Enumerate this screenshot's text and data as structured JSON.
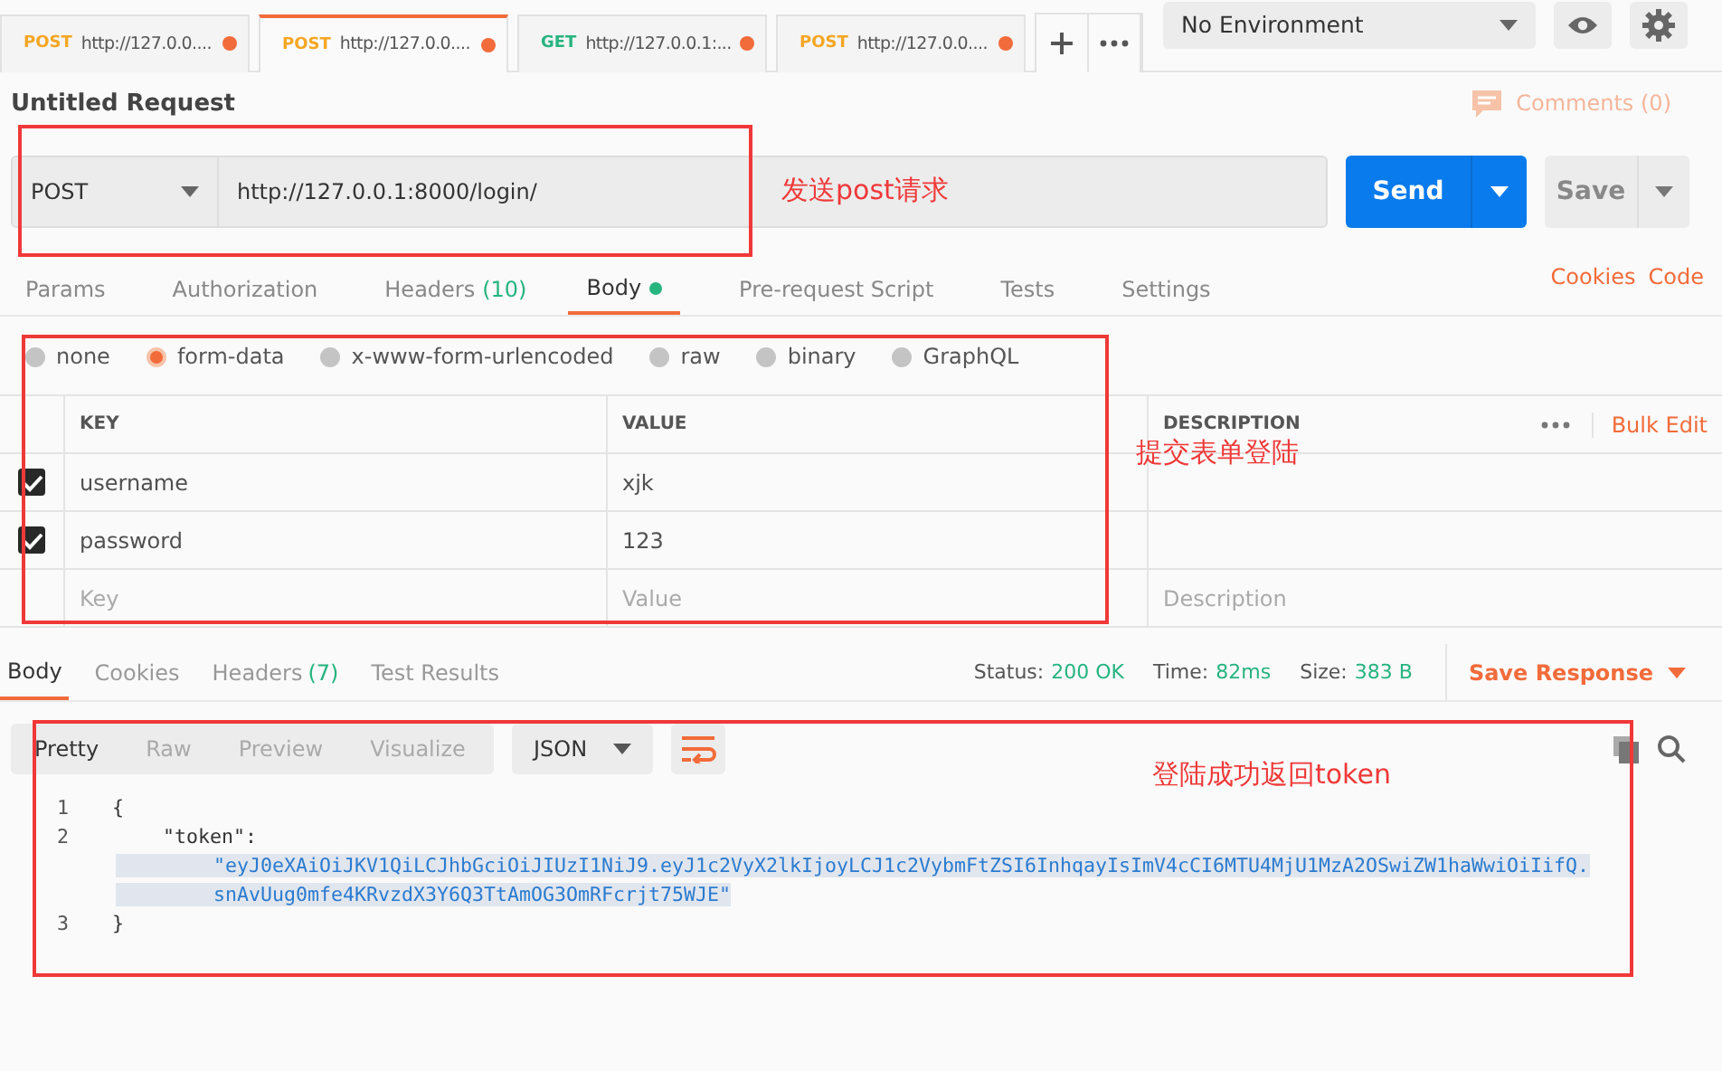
{
  "request_tabs": [
    {
      "method": "POST",
      "url": "http://127.0.0....",
      "selected": false,
      "unsaved": true
    },
    {
      "method": "POST",
      "url": "http://127.0.0....",
      "selected": true,
      "unsaved": true
    },
    {
      "method": "GET",
      "url": "http://127.0.0.1:...",
      "selected": false,
      "unsaved": true
    },
    {
      "method": "POST",
      "url": "http://127.0.0....",
      "selected": false,
      "unsaved": true
    }
  ],
  "environment": {
    "value": "No Environment"
  },
  "request": {
    "title": "Untitled Request",
    "comments": "Comments (0)",
    "method": "POST",
    "url": "http://127.0.0.1:8000/login/",
    "send": "Send",
    "save": "Save"
  },
  "request_sections": [
    {
      "label": "Params",
      "selected": false
    },
    {
      "label": "Authorization",
      "selected": false
    },
    {
      "label": "Headers",
      "count": "(10)",
      "selected": false
    },
    {
      "label": "Body",
      "selected": true,
      "dot": true
    },
    {
      "label": "Pre-request Script",
      "selected": false
    },
    {
      "label": "Tests",
      "selected": false
    },
    {
      "label": "Settings",
      "selected": false
    }
  ],
  "request_links": [
    "Cookies",
    "Code"
  ],
  "body_types": [
    {
      "label": "none",
      "selected": false
    },
    {
      "label": "form-data",
      "selected": true
    },
    {
      "label": "x-www-form-urlencoded",
      "selected": false
    },
    {
      "label": "raw",
      "selected": false
    },
    {
      "label": "binary",
      "selected": false
    },
    {
      "label": "GraphQL",
      "selected": false
    }
  ],
  "params_table": {
    "columns": [
      "KEY",
      "VALUE",
      "DESCRIPTION"
    ],
    "bulk_edit": "Bulk Edit",
    "rows": [
      {
        "key": "username",
        "value": "xjk",
        "checked": true
      },
      {
        "key": "password",
        "value": "123",
        "checked": true
      }
    ],
    "placeholder": {
      "key": "Key",
      "value": "Value",
      "description": "Description"
    }
  },
  "response_tabs": [
    {
      "label": "Body",
      "selected": true
    },
    {
      "label": "Cookies",
      "selected": false
    },
    {
      "label": "Headers",
      "count": "(7)",
      "selected": false
    },
    {
      "label": "Test Results",
      "selected": false
    }
  ],
  "response_meta": [
    {
      "label": "Status:",
      "value": "200 OK"
    },
    {
      "label": "Time:",
      "value": "82ms"
    },
    {
      "label": "Size:",
      "value": "383 B"
    }
  ],
  "save_response": "Save Response",
  "view_modes": [
    {
      "label": "Pretty",
      "selected": true
    },
    {
      "label": "Raw",
      "selected": false
    },
    {
      "label": "Preview",
      "selected": false
    },
    {
      "label": "Visualize",
      "selected": false
    }
  ],
  "format": "JSON",
  "code_lines": [
    {
      "number": "1",
      "text": "{"
    },
    {
      "number": "2",
      "text": "\"token\":",
      "continuation": [
        "\"eyJ0eXAiOiJKV1QiLCJhbGciOiJIUzI1NiJ9.eyJ1c2VyX2lkIjoyLCJ1c2VybmFtZSI6InhqayIsImV4cCI6MTU4MjU1MzA2OSwiZW1haWwiOiIifQ.",
        "snAvUug0mfe4KRvzdX3Y6Q3TtAmOG3OmRFcrjt75WJE\""
      ],
      "selected": true
    },
    {
      "number": "3",
      "text": "}"
    }
  ],
  "annotations": [
    "发送post请求",
    "提交表单登陆",
    "登陆成功返回token"
  ]
}
